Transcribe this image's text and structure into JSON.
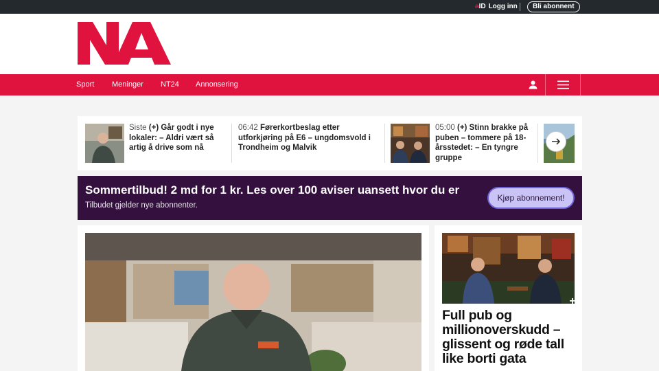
{
  "topbar": {
    "aid_label": "aID",
    "login_label": "Logg inn",
    "subscribe_label": "Bli abonnent"
  },
  "logo": {
    "text": "NA"
  },
  "nav": {
    "items": [
      {
        "label": "Sport"
      },
      {
        "label": "Meninger"
      },
      {
        "label": "NT24"
      },
      {
        "label": "Annonsering"
      }
    ],
    "user_icon": "user-icon",
    "menu_icon": "hamburger-menu-icon"
  },
  "strip": {
    "items": [
      {
        "time": "Siste",
        "title": "(+) Går godt i nye lokaler: – Aldri vært så artig å drive som nå"
      },
      {
        "time": "06:42",
        "title": "Førerkortbeslag etter utforkjøring på E6 – ungdomsvold i Trondheim og Malvik"
      },
      {
        "time": "05:00",
        "title": "(+) Stinn brakke på puben – tommere på 18-årsstedet: – En tyngre gruppe"
      }
    ],
    "next_icon": "arrow-right-icon"
  },
  "promo": {
    "title": "Sommertilbud! 2 md for 1 kr. Les over 100 aviser uansett hvor du er",
    "subtitle": "Tilbudet gjelder nye abonnenter.",
    "button": "Kjøp abonnement!"
  },
  "side_article": {
    "headline": "Full pub og millionoverskudd – glissent og røde tall like borti gata"
  },
  "colors": {
    "brand_red": "#e0133e",
    "promo_purple": "#33103d",
    "topbar": "#23292c"
  }
}
